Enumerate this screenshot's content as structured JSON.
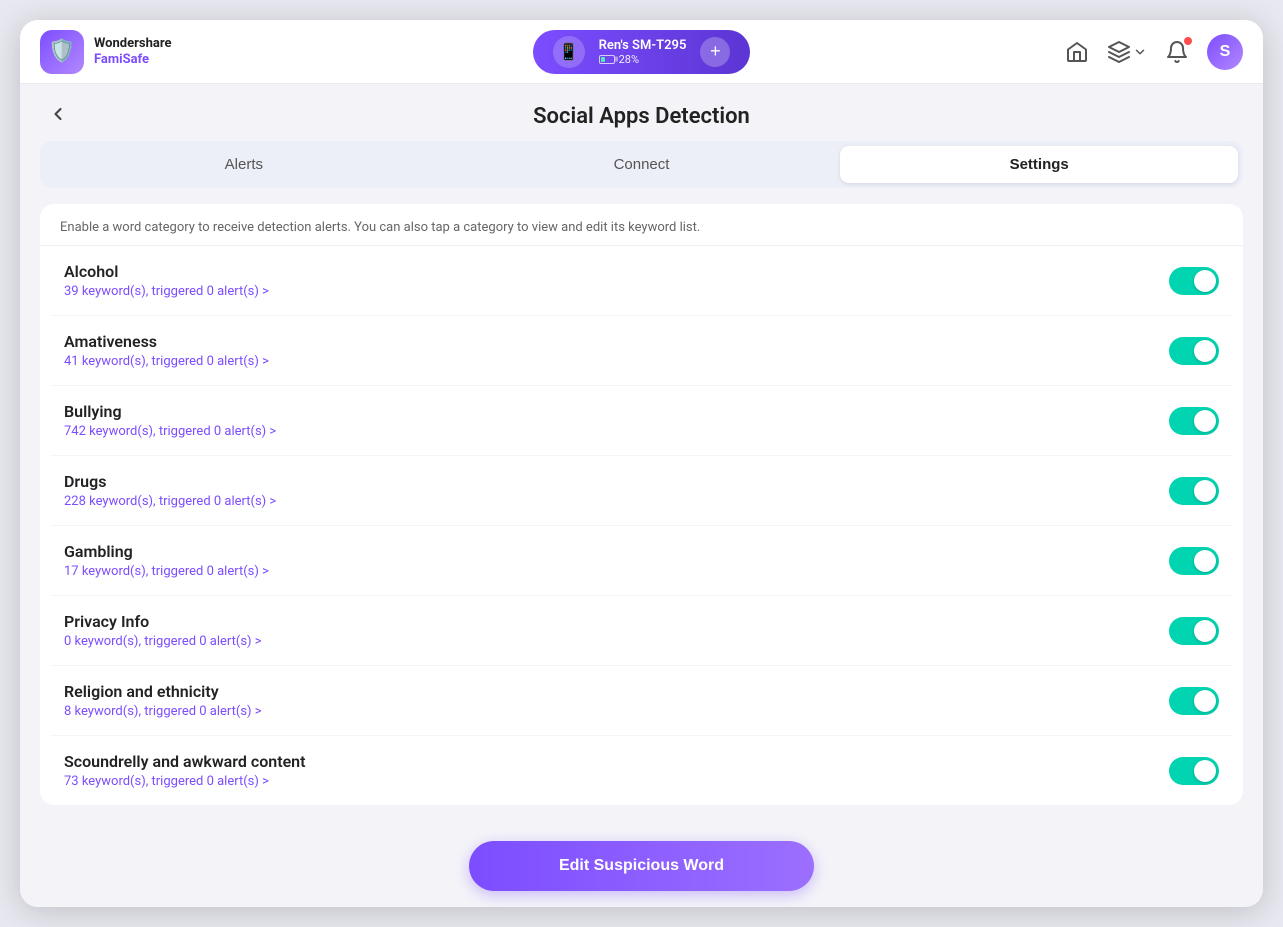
{
  "app": {
    "name": "Wondershare",
    "product": "FamiSafe"
  },
  "device": {
    "name": "Ren's SM-T295",
    "battery": "28%",
    "avatar": "📱"
  },
  "navbar": {
    "add_label": "+",
    "user_initial": "S"
  },
  "page": {
    "title": "Social Apps Detection",
    "back_label": "‹",
    "description": "Enable a word category to receive detection alerts. You can also tap a category to view and edit its keyword list."
  },
  "tabs": [
    {
      "id": "alerts",
      "label": "Alerts",
      "active": false
    },
    {
      "id": "connect",
      "label": "Connect",
      "active": false
    },
    {
      "id": "settings",
      "label": "Settings",
      "active": true
    }
  ],
  "categories": [
    {
      "name": "Alcohol",
      "keywords": "39 keyword(s), triggered 0 alert(s) >",
      "enabled": true
    },
    {
      "name": "Amativeness",
      "keywords": "41 keyword(s), triggered 0 alert(s) >",
      "enabled": true
    },
    {
      "name": "Bullying",
      "keywords": "742 keyword(s), triggered 0 alert(s) >",
      "enabled": true
    },
    {
      "name": "Drugs",
      "keywords": "228 keyword(s), triggered 0 alert(s) >",
      "enabled": true
    },
    {
      "name": "Gambling",
      "keywords": "17 keyword(s), triggered 0 alert(s) >",
      "enabled": true
    },
    {
      "name": "Privacy Info",
      "keywords": "0 keyword(s), triggered 0 alert(s) >",
      "enabled": true
    },
    {
      "name": "Religion and ethnicity",
      "keywords": "8 keyword(s), triggered 0 alert(s) >",
      "enabled": true
    },
    {
      "name": "Scoundrelly and awkward content",
      "keywords": "73 keyword(s), triggered 0 alert(s) >",
      "enabled": true
    }
  ],
  "bottom": {
    "edit_btn_label": "Edit Suspicious Word"
  }
}
